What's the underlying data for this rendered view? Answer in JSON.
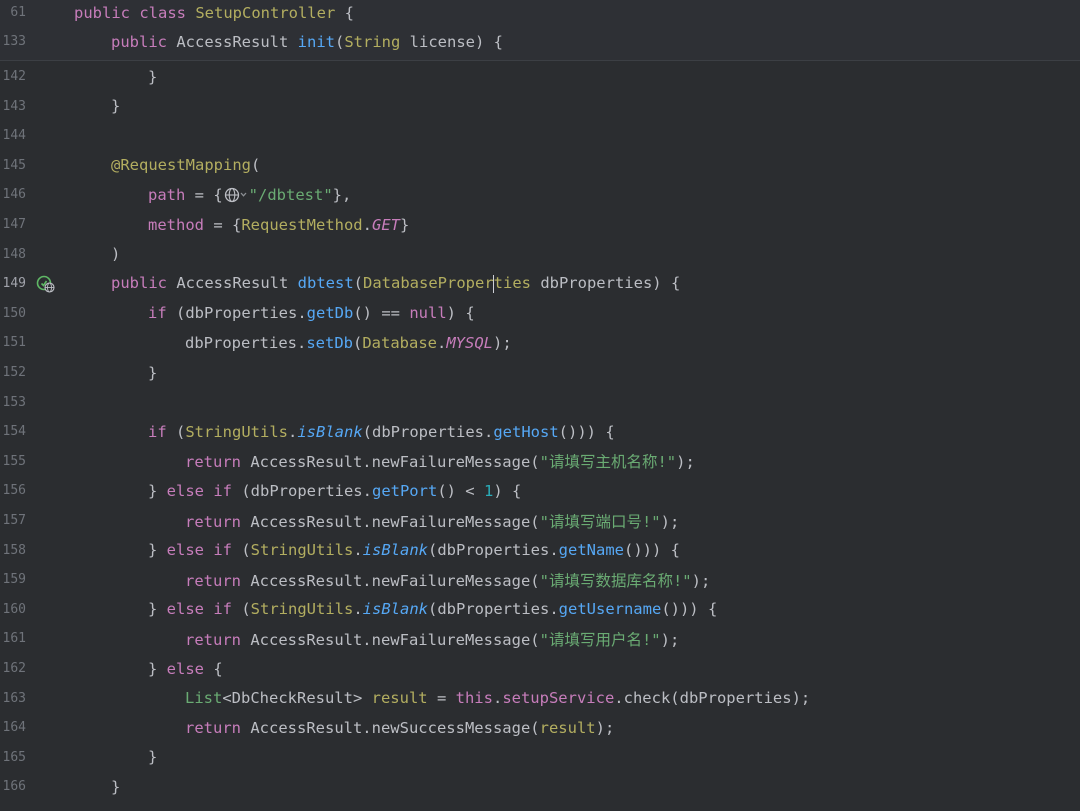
{
  "sticky": [
    {
      "num": "61",
      "indent": 0,
      "t": [
        [
          "kw2",
          "public "
        ],
        [
          "kw2",
          "class "
        ],
        [
          "ann",
          "SetupController "
        ],
        [
          "plain",
          "{"
        ]
      ]
    },
    {
      "num": "133",
      "indent": 1,
      "t": [
        [
          "kw2",
          "public "
        ],
        [
          "plain",
          "AccessResult "
        ],
        [
          "fn",
          "init"
        ],
        [
          "plain",
          "("
        ],
        [
          "ann",
          "String "
        ],
        [
          "plain",
          "license) {"
        ]
      ]
    }
  ],
  "lines": [
    {
      "num": "142",
      "indent": 2,
      "t": [
        [
          "plain",
          "}"
        ]
      ]
    },
    {
      "num": "143",
      "indent": 1,
      "t": [
        [
          "plain",
          "}"
        ]
      ]
    },
    {
      "num": "144",
      "indent": 0,
      "t": []
    },
    {
      "num": "145",
      "indent": 1,
      "t": [
        [
          "ann",
          "@RequestMapping"
        ],
        [
          "plain",
          "("
        ]
      ]
    },
    {
      "num": "146",
      "indent": 2,
      "t": [
        [
          "fld",
          "path "
        ],
        [
          "plain",
          "= {"
        ],
        [
          "globe",
          ""
        ],
        [
          "str",
          "\"/dbtest\""
        ],
        [
          "plain",
          "},"
        ]
      ]
    },
    {
      "num": "147",
      "indent": 2,
      "t": [
        [
          "fld",
          "method "
        ],
        [
          "plain",
          "= {"
        ],
        [
          "ann",
          "RequestMethod"
        ],
        [
          "plain",
          "."
        ],
        [
          "const",
          "GET"
        ],
        [
          "plain",
          "}"
        ]
      ]
    },
    {
      "num": "148",
      "indent": 1,
      "t": [
        [
          "plain",
          ")"
        ]
      ]
    },
    {
      "num": "149",
      "indent": 1,
      "run": true,
      "t": [
        [
          "kw2",
          "public "
        ],
        [
          "plain",
          "AccessResult "
        ],
        [
          "fn",
          "dbtest"
        ],
        [
          "plain",
          "("
        ],
        [
          "ann",
          "DatabaseProper"
        ],
        [
          "caret",
          ""
        ],
        [
          "ann",
          "ties"
        ],
        [
          "plain",
          " dbProperties) {"
        ]
      ]
    },
    {
      "num": "150",
      "indent": 2,
      "t": [
        [
          "kw2",
          "if "
        ],
        [
          "plain",
          "(dbProperties."
        ],
        [
          "fn",
          "getDb"
        ],
        [
          "plain",
          "() == "
        ],
        [
          "kw2",
          "null"
        ],
        [
          "plain",
          ") {"
        ]
      ]
    },
    {
      "num": "151",
      "indent": 3,
      "t": [
        [
          "plain",
          "dbProperties."
        ],
        [
          "fn",
          "setDb"
        ],
        [
          "plain",
          "("
        ],
        [
          "ann",
          "Database"
        ],
        [
          "plain",
          "."
        ],
        [
          "const",
          "MYSQL"
        ],
        [
          "plain",
          ");"
        ]
      ]
    },
    {
      "num": "152",
      "indent": 2,
      "t": [
        [
          "plain",
          "}"
        ]
      ]
    },
    {
      "num": "153",
      "indent": 0,
      "t": []
    },
    {
      "num": "154",
      "indent": 2,
      "t": [
        [
          "kw2",
          "if "
        ],
        [
          "plain",
          "("
        ],
        [
          "ann",
          "StringUtils"
        ],
        [
          "plain",
          "."
        ],
        [
          "stat",
          "isBlank"
        ],
        [
          "plain",
          "(dbProperties."
        ],
        [
          "fn",
          "getHost"
        ],
        [
          "plain",
          "())) {"
        ]
      ]
    },
    {
      "num": "155",
      "indent": 3,
      "t": [
        [
          "kw2",
          "return "
        ],
        [
          "plain",
          "AccessResult.newFailureMessage("
        ],
        [
          "str",
          "\"请填写主机名称!\""
        ],
        [
          "plain",
          ");"
        ]
      ]
    },
    {
      "num": "156",
      "indent": 2,
      "t": [
        [
          "plain",
          "} "
        ],
        [
          "kw2",
          "else if "
        ],
        [
          "plain",
          "(dbProperties."
        ],
        [
          "fn",
          "getPort"
        ],
        [
          "plain",
          "() < "
        ],
        [
          "num",
          "1"
        ],
        [
          "plain",
          ") {"
        ]
      ]
    },
    {
      "num": "157",
      "indent": 3,
      "t": [
        [
          "kw2",
          "return "
        ],
        [
          "plain",
          "AccessResult.newFailureMessage("
        ],
        [
          "str",
          "\"请填写端口号!\""
        ],
        [
          "plain",
          ");"
        ]
      ]
    },
    {
      "num": "158",
      "indent": 2,
      "t": [
        [
          "plain",
          "} "
        ],
        [
          "kw2",
          "else if "
        ],
        [
          "plain",
          "("
        ],
        [
          "ann",
          "StringUtils"
        ],
        [
          "plain",
          "."
        ],
        [
          "stat",
          "isBlank"
        ],
        [
          "plain",
          "(dbProperties."
        ],
        [
          "fn",
          "getName"
        ],
        [
          "plain",
          "())) {"
        ]
      ]
    },
    {
      "num": "159",
      "indent": 3,
      "t": [
        [
          "kw2",
          "return "
        ],
        [
          "plain",
          "AccessResult.newFailureMessage("
        ],
        [
          "str",
          "\"请填写数据库名称!\""
        ],
        [
          "plain",
          ");"
        ]
      ]
    },
    {
      "num": "160",
      "indent": 2,
      "t": [
        [
          "plain",
          "} "
        ],
        [
          "kw2",
          "else if "
        ],
        [
          "plain",
          "("
        ],
        [
          "ann",
          "StringUtils"
        ],
        [
          "plain",
          "."
        ],
        [
          "stat",
          "isBlank"
        ],
        [
          "plain",
          "(dbProperties."
        ],
        [
          "fn",
          "getUsername"
        ],
        [
          "plain",
          "())) {"
        ]
      ]
    },
    {
      "num": "161",
      "indent": 3,
      "t": [
        [
          "kw2",
          "return "
        ],
        [
          "plain",
          "AccessResult.newFailureMessage("
        ],
        [
          "str",
          "\"请填写用户名!\""
        ],
        [
          "plain",
          ");"
        ]
      ]
    },
    {
      "num": "162",
      "indent": 2,
      "t": [
        [
          "plain",
          "} "
        ],
        [
          "kw2",
          "else "
        ],
        [
          "plain",
          "{"
        ]
      ]
    },
    {
      "num": "163",
      "indent": 3,
      "t": [
        [
          "grn",
          "List"
        ],
        [
          "plain",
          "<DbCheckResult> "
        ],
        [
          "ann",
          "result "
        ],
        [
          "plain",
          "= "
        ],
        [
          "kw2",
          "this"
        ],
        [
          "plain",
          "."
        ],
        [
          "fld",
          "setupService"
        ],
        [
          "plain",
          ".check(dbProperties);"
        ]
      ]
    },
    {
      "num": "164",
      "indent": 3,
      "t": [
        [
          "kw2",
          "return "
        ],
        [
          "plain",
          "AccessResult.newSuccessMessage("
        ],
        [
          "ann",
          "result"
        ],
        [
          "plain",
          ");"
        ]
      ]
    },
    {
      "num": "165",
      "indent": 2,
      "t": [
        [
          "plain",
          "}"
        ]
      ]
    },
    {
      "num": "166",
      "indent": 1,
      "t": [
        [
          "plain",
          "}"
        ]
      ]
    }
  ]
}
